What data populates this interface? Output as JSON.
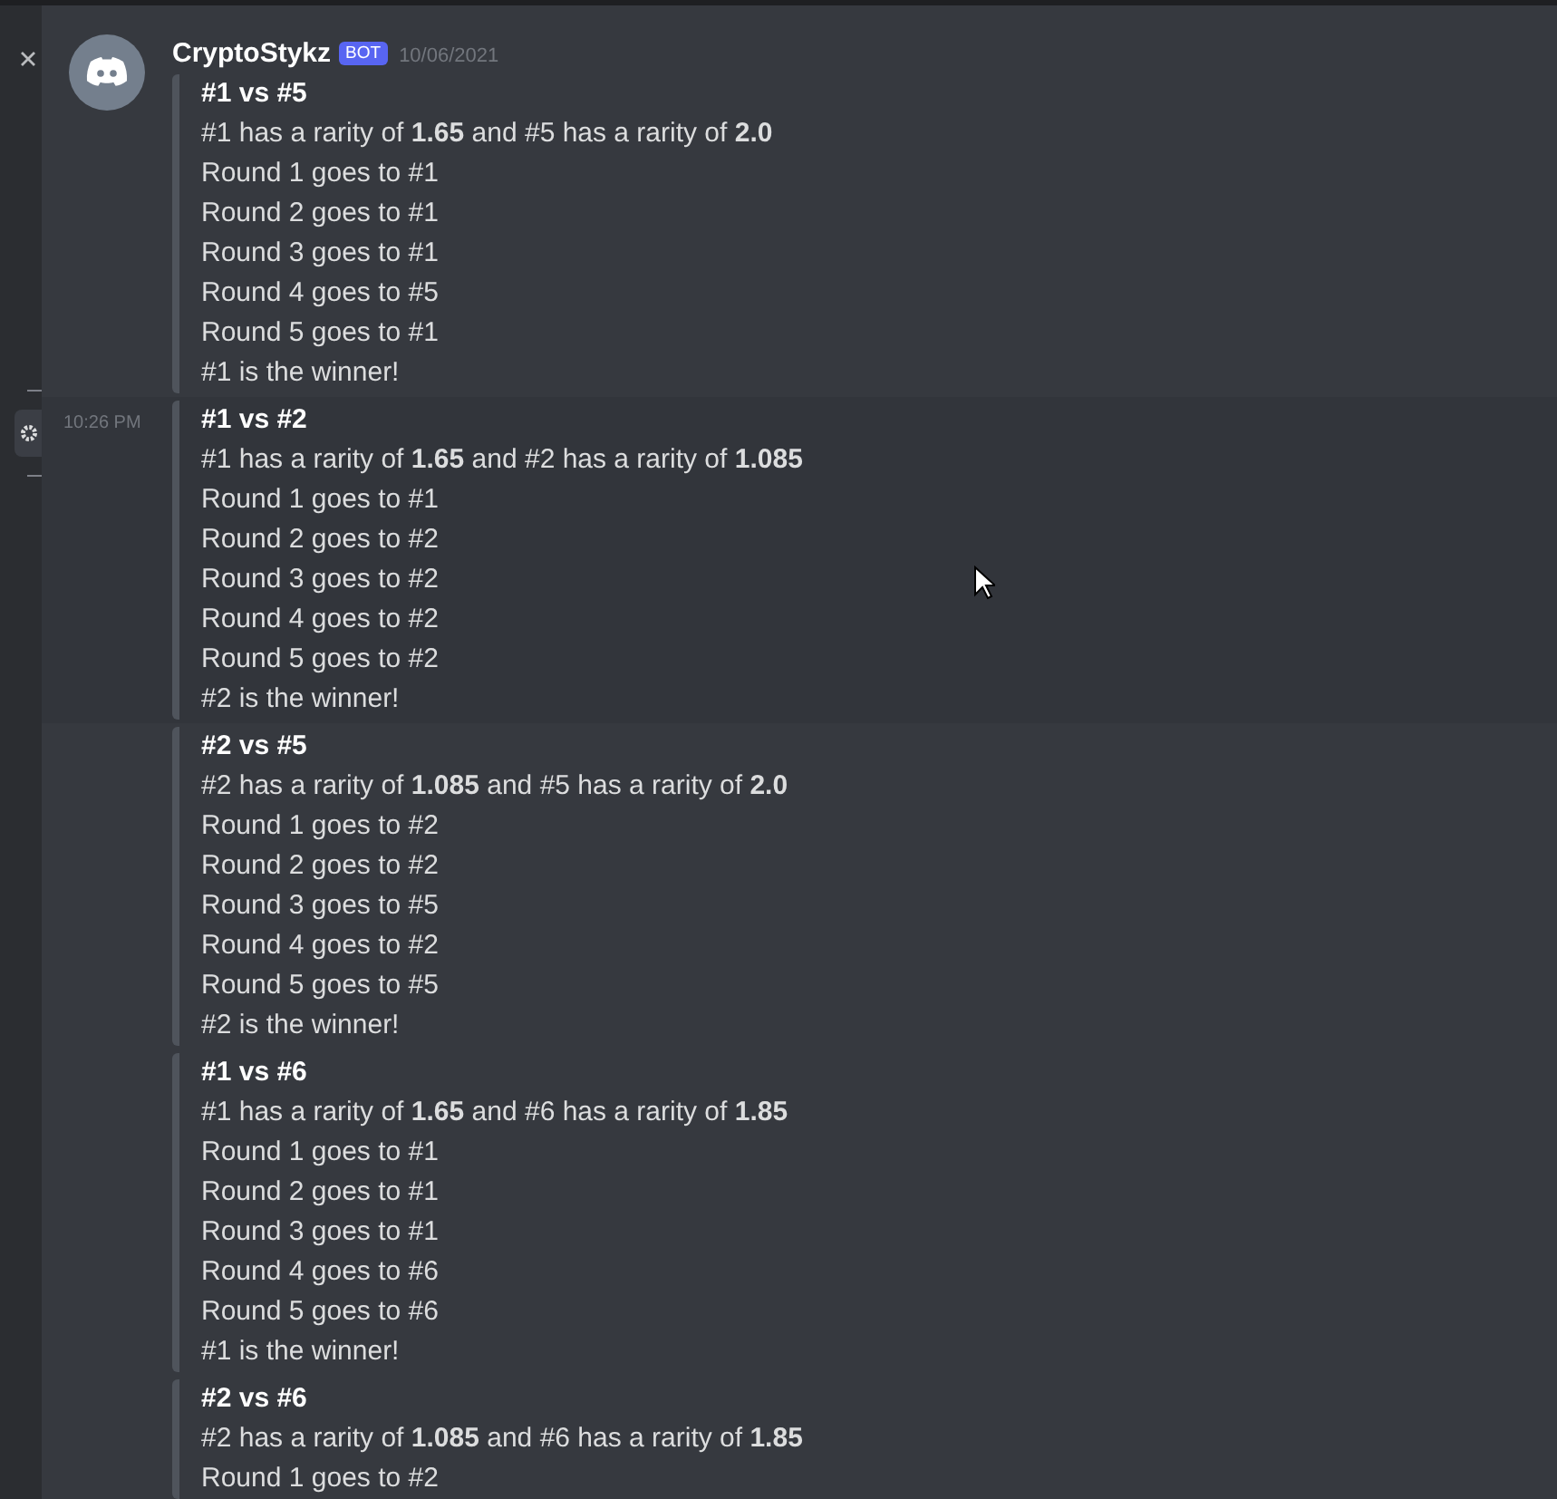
{
  "sidebar_items": [
    {
      "kind": "close",
      "selected": false
    },
    {
      "kind": "settings",
      "selected": true
    }
  ],
  "author": {
    "name": "CryptoStykz",
    "badge": "BOT",
    "timestamp": "10/06/2021"
  },
  "messages": [
    {
      "embed": {
        "title": "#1 vs #5",
        "lines": [
          "#1 has a rarity of **1.65** and #5 has a rarity of **2.0**",
          "Round 1 goes to #1",
          "Round 2 goes to #1",
          "Round 3 goes to #1",
          "Round 4 goes to #5",
          "Round 5 goes to #1",
          "#1 is the winner!"
        ]
      }
    },
    {
      "time": "10:26 PM",
      "embed": {
        "title": "#1 vs #2",
        "lines": [
          "#1 has a rarity of **1.65** and #2 has a rarity of **1.085**",
          "Round 1 goes to #1",
          "Round 2 goes to #2",
          "Round 3 goes to #2",
          "Round 4 goes to #2",
          "Round 5 goes to #2",
          "#2 is the winner!"
        ]
      }
    },
    {
      "embed": {
        "title": "#2 vs #5",
        "lines": [
          "#2 has a rarity of **1.085** and #5 has a rarity of **2.0**",
          "Round 1 goes to #2",
          "Round 2 goes to #2",
          "Round 3 goes to #5",
          "Round 4 goes to #2",
          "Round 5 goes to #5",
          "#2 is the winner!"
        ]
      }
    },
    {
      "embed": {
        "title": "#1 vs #6",
        "lines": [
          "#1 has a rarity of **1.65** and #6 has a rarity of **1.85**",
          "Round 1 goes to #1",
          "Round 2 goes to #1",
          "Round 3 goes to #1",
          "Round 4 goes to #6",
          "Round 5 goes to #6",
          "#1 is the winner!"
        ]
      }
    },
    {
      "embed": {
        "title": "#2 vs #6",
        "lines": [
          "#2 has a rarity of **1.085** and #6 has a rarity of **1.85**",
          "Round 1 goes to #2"
        ]
      }
    }
  ]
}
